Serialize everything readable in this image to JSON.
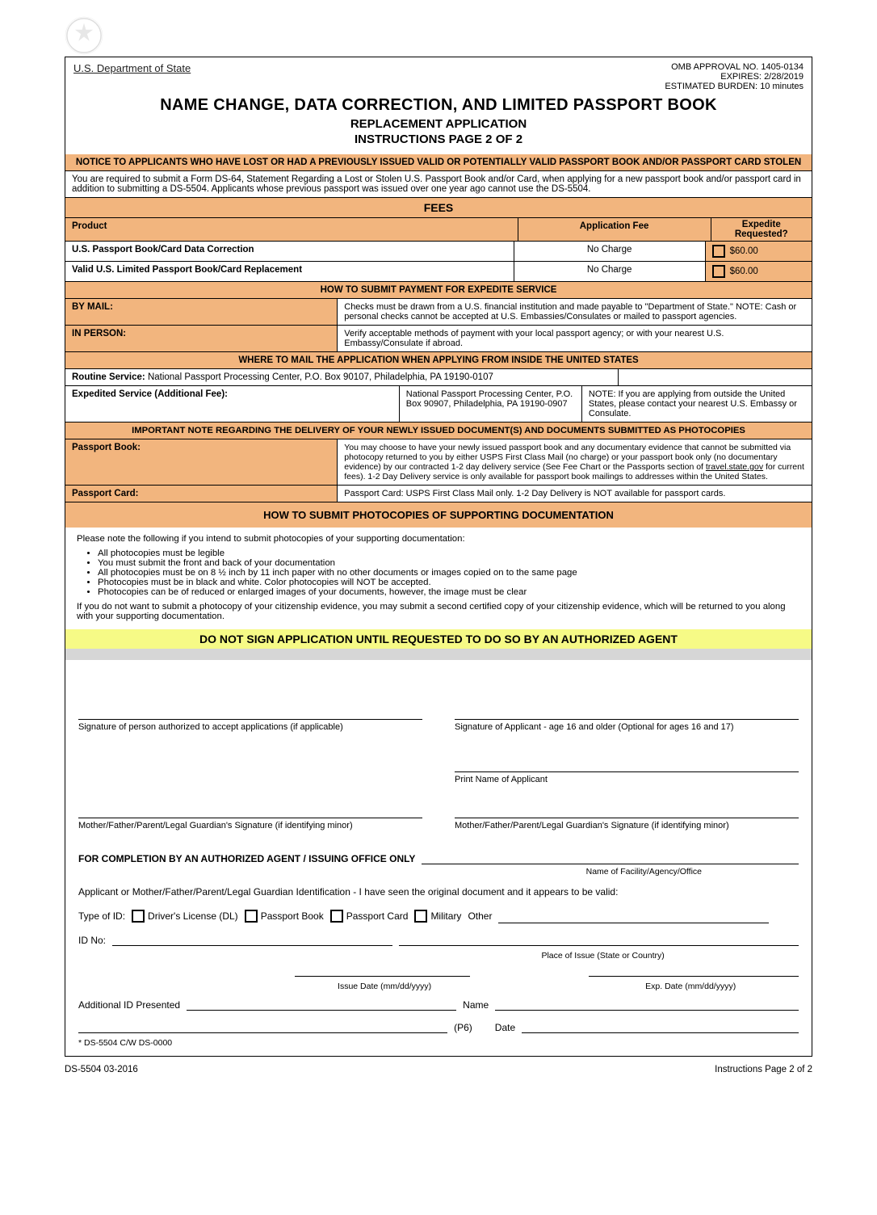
{
  "header": {
    "dept": "U.S. Department of State",
    "omb_label": "OMB APPROVAL NO.",
    "omb_no": "1405-0134",
    "expires_label": "EXPIRES:",
    "expires": "2/28/2019",
    "burden_label": "ESTIMATED BURDEN:",
    "burden": "10 minutes"
  },
  "title": {
    "line1": "NAME CHANGE, DATA CORRECTION, AND LIMITED PASSPORT BOOK",
    "line2": "REPLACEMENT APPLICATION",
    "line3": "INSTRUCTIONS PAGE 2 OF 2"
  },
  "notice": {
    "heading": "NOTICE TO APPLICANTS WHO HAVE LOST OR HAD A PREVIOUSLY ISSUED VALID OR POTENTIALLY VALID PASSPORT BOOK AND/OR PASSPORT CARD STOLEN",
    "body": "You are required to submit a Form DS-64, Statement Regarding a Lost or Stolen U.S. Passport Book and/or Card, when applying for a new passport book and/or passport card in addition to submitting a DS-5504. Applicants whose previous passport was issued over one year ago cannot use the DS-5504."
  },
  "feesHeading": "FEES",
  "fees": {
    "row1": {
      "product": "U.S. Passport Book/Card Data Correction",
      "fee": "No Charge",
      "expedite": "$60.00"
    },
    "row2": {
      "product": "Valid U.S. Limited Passport Book/Card Replacement",
      "fee": "No Charge",
      "expedite_cb": "$60.00"
    },
    "expedite_header": "Expedite Requested?"
  },
  "pay": {
    "heading": "HOW TO SUBMIT PAYMENT FOR EXPEDITE SERVICE",
    "mail_label": "BY MAIL:",
    "mail_text": "Checks must be drawn from a U.S. financial institution and made payable to \"Department of State.\" NOTE: Cash or personal checks cannot be accepted at U.S. Embassies/Consulates or mailed to passport agencies.",
    "inperson_label": "IN PERSON:",
    "inperson_text": "Verify acceptable methods of payment with your local passport agency; or with your nearest U.S. Embassy/Consulate if abroad."
  },
  "mail": {
    "heading": "WHERE TO MAIL THE APPLICATION WHEN APPLYING FROM INSIDE THE UNITED STATES",
    "rt_label": "Routine Service:",
    "rt_addr": " National Passport Processing Center, P.O. Box 90107, Philadelphia, PA 19190-0107",
    "ex_label": "Expedited Service (Additional Fee):",
    "ex_addr": " National Passport Processing Center, P.O. Box 90907, Philadelphia, PA 19190-0907",
    "note": "NOTE: If you are applying from outside the United States, please contact your nearest U.S. Embassy or Consulate."
  },
  "delivery": {
    "heading": "IMPORTANT NOTE REGARDING THE DELIVERY OF YOUR NEWLY ISSUED DOCUMENT(S) AND DOCUMENTS SUBMITTED AS PHOTOCOPIES",
    "item1": "Passport Book: You may choose to have your newly issued passport book and any documentary evidence that cannot be submitted via photocopy returned to you by either USPS First Class Mail (no charge) or your passport book only (no documentary evidence) by our contracted 1-2 day delivery service (See Fee Chart or the Passports section of travel.state.gov for current fees). 1-2 Day Delivery service is only available for passport book mailings to addresses within the United States.",
    "item2": "Passport Card: USPS First Class Mail only. 1-2 Day Delivery is NOT available for passport cards."
  },
  "submitcopies": {
    "heading": "HOW TO SUBMIT PHOTOCOPIES OF SUPPORTING DOCUMENTATION",
    "body1": "Please note the following if you intend to submit photocopies of your supporting documentation:",
    "bullets": [
      "All photocopies must be legible",
      "You must submit the front and back of your documentation",
      "All photocopies must be on 8 ½ inch by 11 inch paper with no other documents or images copied on to the same page",
      "Photocopies must be in black and white. Color photocopies will NOT be accepted.",
      "Photocopies can be of reduced or enlarged images of your documents, however, the image must be clear"
    ],
    "body2": "If you do not want to submit a photocopy of your citizenship evidence, you may submit a second certified copy of your citizenship evidence, which will be returned to you along with your supporting documentation."
  },
  "yellow": "DO NOT SIGN APPLICATION UNTIL REQUESTED TO DO SO BY AN AUTHORIZED AGENT",
  "sig": {
    "col1": "Signature of person authorized to accept applications (if applicable)",
    "col2": "Signature of Applicant - age 16 and older (Optional for ages 16 and 17)",
    "print": "Print Name of Applicant",
    "mom": "Mother/Father/Parent/Legal Guardian's Signature (if identifying minor)",
    "dad": "Mother/Father/Parent/Legal Guardian's Signature (if identifying minor)"
  },
  "comp": {
    "heading": "FOR COMPLETION BY AN AUTHORIZED AGENT / ISSUING OFFICE ONLY",
    "facility": "Name of Facility/Agency/Office",
    "id_presented": "Applicant or Mother/Father/Parent/Legal Guardian Identification - I have seen the original document and it appears to be valid:",
    "id_no": "ID No:",
    "types": {
      "label": "Type of ID:",
      "dl": "Driver's License (DL)",
      "pb": "Passport Book",
      "pc": "Passport Card",
      "mil": "Military",
      "other": "Other"
    },
    "place": "Place of Issue (State or Country)",
    "issue_date": "Issue Date (mm/dd/yyyy)",
    "exp_date": "Exp. Date (mm/dd/yyyy)",
    "addl": "Additional ID Presented",
    "name_line": "Name",
    "none": "* DS-5504 C/W DS-0000",
    "p6": "(P6)",
    "date": "Date"
  },
  "footer": {
    "left": "DS-5504    03-2016",
    "center": "Instructions Page 2 of 2"
  }
}
